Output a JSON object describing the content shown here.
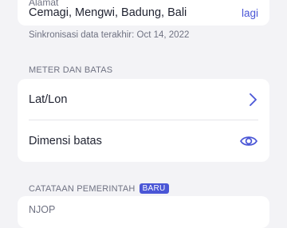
{
  "address_card": {
    "label": "Alamat",
    "value": "Cemagi, Mengwi, Badung, Bali",
    "action_label": "lagi"
  },
  "sync_text": "Sinkronisasi data terakhir: Oct 14, 2022",
  "meter_section": {
    "header": "METER DAN BATAS",
    "rows": [
      {
        "label": "Lat/Lon",
        "icon": "chevron-right-icon"
      },
      {
        "label": "Dimensi batas",
        "icon": "eye-icon"
      }
    ]
  },
  "gov_section": {
    "header": "CATATAAN PEMERINTAH",
    "badge": "BARU",
    "first_item": "NJOP"
  },
  "colors": {
    "background": "#f3f3f6",
    "card": "#ffffff",
    "accent": "#4a56d6",
    "muted_text": "#6f7282",
    "primary_text": "#1f2230"
  }
}
